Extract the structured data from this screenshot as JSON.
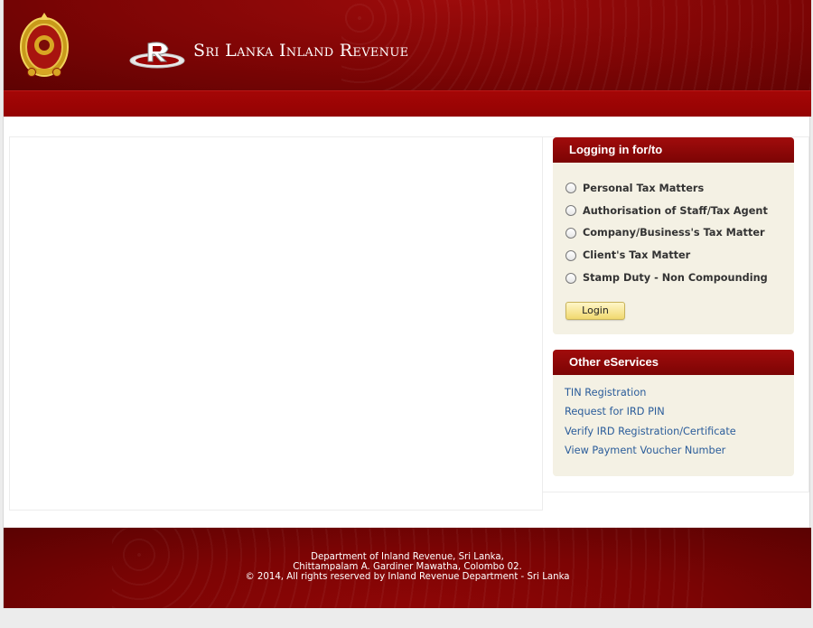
{
  "header": {
    "title": "Sri Lanka Inland Revenue",
    "logo_letter": "R"
  },
  "login_panel": {
    "heading": "Logging in for/to",
    "options": [
      "Personal Tax Matters",
      "Authorisation of Staff/Tax Agent",
      "Company/Business's Tax Matter",
      "Client's Tax Matter",
      "Stamp Duty - Non Compounding"
    ],
    "login_label": "Login"
  },
  "other_panel": {
    "heading": "Other eServices",
    "links": [
      "TIN Registration",
      "Request for IRD PIN",
      "Verify IRD Registration/Certificate",
      "View Payment Voucher Number"
    ]
  },
  "footer": {
    "line1": "Department of Inland Revenue, Sri Lanka,",
    "line2": "Chittampalam A. Gardiner Mawatha, Colombo 02.",
    "line3": "© 2014, All rights reserved by Inland Revenue Department - Sri Lanka"
  },
  "colors": {
    "header_red": "#7e0505",
    "panel_bg": "#f4f1e4",
    "link_blue": "#2a5c9a",
    "button_yellow": "#f1d96f"
  }
}
